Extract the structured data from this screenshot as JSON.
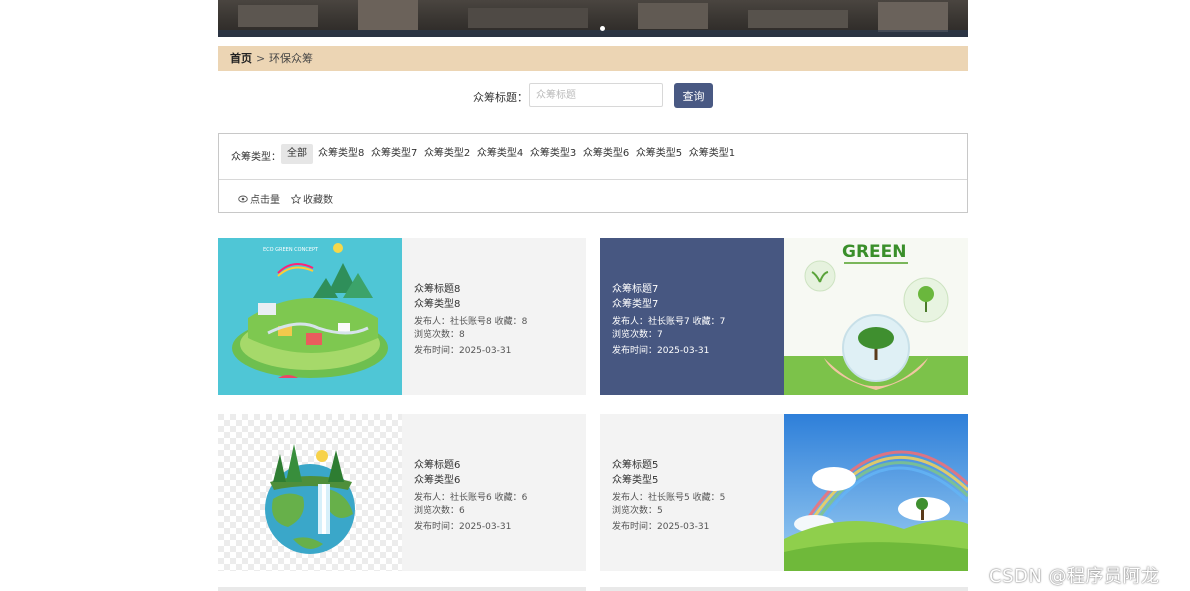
{
  "breadcrumb": {
    "home": "首页",
    "separator": ">",
    "current": "环保众筹"
  },
  "search": {
    "label": "众筹标题：",
    "placeholder": "众筹标题",
    "value": "",
    "button": "查询"
  },
  "filter": {
    "title": "众筹类型：",
    "types": [
      "全部",
      "众筹类型8",
      "众筹类型7",
      "众筹类型2",
      "众筹类型4",
      "众筹类型3",
      "众筹类型6",
      "众筹类型5",
      "众筹类型1"
    ],
    "active": "全部",
    "sort": [
      {
        "icon": "eye-icon",
        "label": "点击量"
      },
      {
        "icon": "star-icon",
        "label": "收藏数"
      }
    ]
  },
  "cards": [
    {
      "title": "众筹标题8",
      "type": "众筹类型8",
      "publisher": "发布人：社长账号8   收藏：8",
      "views": "浏览次数：8",
      "date": "发布时间：2025-03-31",
      "image": "eco-green-concept-illustration"
    },
    {
      "title": "众筹标题7",
      "type": "众筹类型7",
      "publisher": "发布人：社长账号7   收藏：7",
      "views": "浏览次数：7",
      "date": "发布时间：2025-03-31",
      "image": "green-globe-hands-photo"
    },
    {
      "title": "众筹标题6",
      "type": "众筹类型6",
      "publisher": "发布人：社长账号6   收藏：6",
      "views": "浏览次数：6",
      "date": "发布时间：2025-03-31",
      "image": "earth-waterfall-illustration"
    },
    {
      "title": "众筹标题5",
      "type": "众筹类型5",
      "publisher": "发布人：社长账号5   收藏：5",
      "views": "浏览次数：5",
      "date": "发布时间：2025-03-31",
      "image": "rainbow-meadow-photo"
    }
  ],
  "image_text": {
    "green_logo": "GREEN",
    "eco_concept": "ECO GREEN CONCEPT"
  },
  "watermark": "CSDN @程序员阿龙",
  "colors": {
    "accent": "#495983",
    "crumb_bg": "#ecd5b4",
    "card_hover": "#475781",
    "card_bg": "#f3f3f3"
  }
}
